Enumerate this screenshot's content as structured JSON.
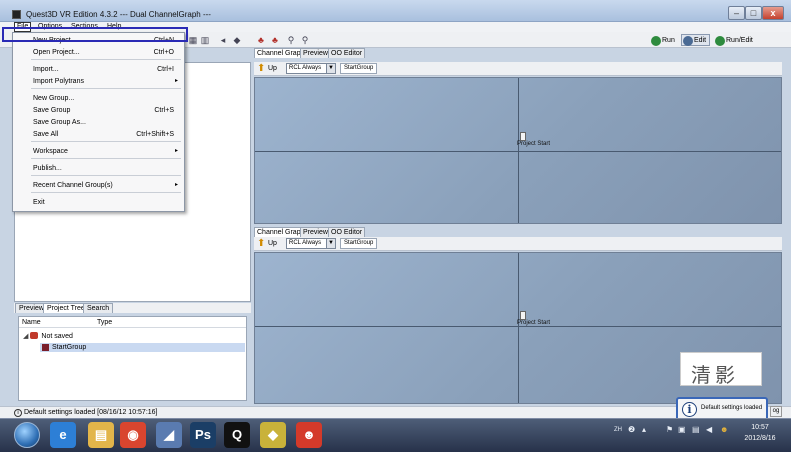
{
  "window": {
    "title": "Quest3D VR Edition 4.3.2   --- Dual ChannelGraph ---",
    "minimize_glyph": "–",
    "maximize_glyph": "□",
    "close_glyph": "x"
  },
  "menubar": {
    "file": "File",
    "options": "Options",
    "sections": "Sections",
    "help": "Help"
  },
  "modes": {
    "run": "Run",
    "edit": "Edit",
    "run_edit": "Run/Edit"
  },
  "file_menu": {
    "items": [
      {
        "label": "New Project...",
        "shortcut": "Ctrl+N"
      },
      {
        "label": "Open Project...",
        "shortcut": "Ctrl+O"
      },
      {
        "label": "Import...",
        "shortcut": "Ctrl+I"
      },
      {
        "label": "Import Polytrans",
        "submenu": "▸"
      },
      {
        "label": "New Group..."
      },
      {
        "label": "Save Group",
        "shortcut": "Ctrl+S"
      },
      {
        "label": "Save Group As..."
      },
      {
        "label": "Save All",
        "shortcut": "Ctrl+Shift+S"
      },
      {
        "label": "Workspace",
        "submenu": "▸"
      },
      {
        "label": "Publish..."
      },
      {
        "label": "Recent Channel Group(s)",
        "submenu": "▸"
      },
      {
        "label": "Exit"
      }
    ]
  },
  "top_pane": {
    "tabs": [
      "Channel Graph",
      "Preview",
      "OO Editor"
    ],
    "up_label": "Up",
    "rcl_value": "RCL Always",
    "group_tab": "StartGroup",
    "node_label": "Project Start"
  },
  "bottom_pane": {
    "tabs": [
      "Channel Graph",
      "Preview",
      "OO Editor"
    ],
    "up_label": "Up",
    "rcl_value": "RCL Always",
    "group_tab": "StartGroup",
    "node_label": "Project Start"
  },
  "left_tabs": [
    "Preview",
    "Project Tree",
    "Search"
  ],
  "project_tree": {
    "col_name": "Name",
    "col_type": "Type",
    "root_label": "Not saved",
    "child_label": "StartGroup"
  },
  "status": {
    "text": "Default settings loaded [08/16/12 10:57:16]"
  },
  "notification": {
    "text": "Default settings loaded",
    "icon_glyph": "i",
    "hidden_label": "og"
  },
  "watermark": {
    "text": "清影"
  },
  "taskbar": {
    "apps": [
      {
        "name": "internet-explorer",
        "glyph": "e",
        "color": "#2d7fd6"
      },
      {
        "name": "file-explorer",
        "glyph": "▤",
        "color": "#e2b54a"
      },
      {
        "name": "chrome",
        "glyph": "◉",
        "color": "#d9452f"
      },
      {
        "name": "media",
        "glyph": "◢",
        "color": "#5a7bb0"
      },
      {
        "name": "photoshop",
        "glyph": "Ps",
        "color": "#1b3e66"
      },
      {
        "name": "quest3d",
        "glyph": "Q",
        "color": "#111111"
      },
      {
        "name": "folder",
        "glyph": "◆",
        "color": "#c9b23a"
      },
      {
        "name": "qq",
        "glyph": "☻",
        "color": "#d43a2a"
      }
    ],
    "tray_lang": "ZH",
    "clock_time": "10:57",
    "clock_date": "2012/8/16"
  },
  "colors": {
    "highlight_border": "#2a2ab5",
    "canvas": "#8ea4be",
    "taskbar": "#3a4862"
  }
}
